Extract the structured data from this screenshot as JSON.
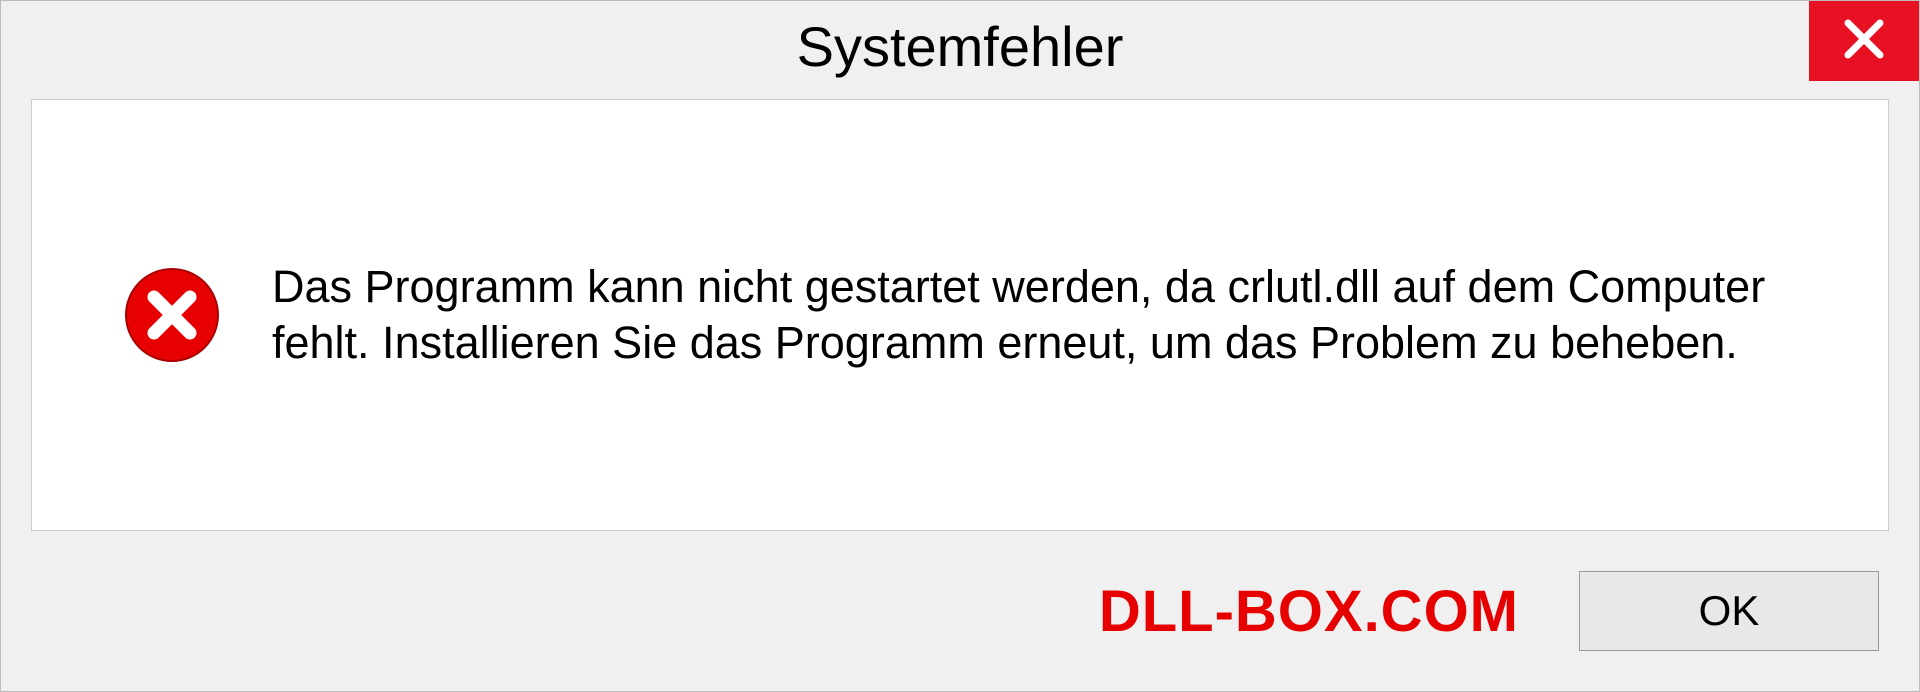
{
  "dialog": {
    "title": "Systemfehler",
    "message": "Das Programm kann nicht gestartet werden, da crlutl.dll auf dem Computer fehlt. Installieren Sie das Programm erneut, um das Problem zu beheben.",
    "ok_label": "OK"
  },
  "watermark": "DLL-BOX.COM"
}
